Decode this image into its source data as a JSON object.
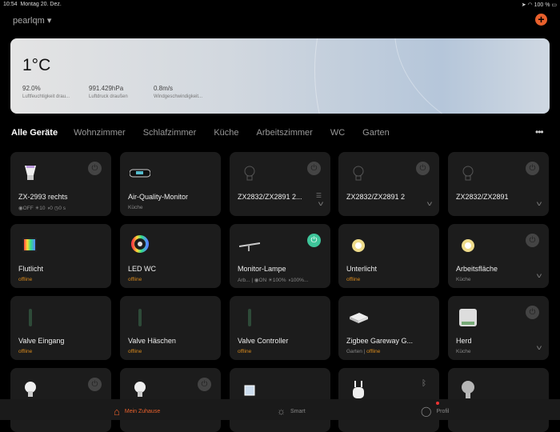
{
  "status_bar": {
    "time": "10:54",
    "date": "Montag 20. Dez.",
    "battery": "100 %"
  },
  "header": {
    "home_name": "pearlqm",
    "add_icon": "plus-icon"
  },
  "weather": {
    "temperature": "1°C",
    "stats": [
      {
        "value": "92.0%",
        "label": "Luftfeuchtigkeit drau..."
      },
      {
        "value": "991.429hPa",
        "label": "Luftdruck draußen"
      },
      {
        "value": "0.8m/s",
        "label": "Windgeschwindigkeit..."
      }
    ]
  },
  "tabs": [
    "Alle Geräte",
    "Wohnzimmer",
    "Schlafzimmer",
    "Küche",
    "Arbeitszimmer",
    "WC",
    "Garten"
  ],
  "more_label": "•••",
  "colors": {
    "accent": "#e8602c",
    "on": "#3ec59a",
    "offline": "#d88a1c",
    "card": "#1c1c1c"
  },
  "devices": [
    {
      "name": "ZX-2993 rechts",
      "sub": "◉OFF  ☀10  ◑0  ◷0 s",
      "icon": "spot-bulb",
      "power": "off"
    },
    {
      "name": "Air-Quality-Monitor",
      "sub": "Küche",
      "icon": "air-monitor"
    },
    {
      "name": "ZX2832/ZX2891 2...",
      "sub": "",
      "icon": "bulb-outline",
      "power": "off",
      "chevron": true,
      "group": true
    },
    {
      "name": "ZX2832/ZX2891 2",
      "sub": "",
      "icon": "bulb-outline",
      "power": "off",
      "chevron": true
    },
    {
      "name": "ZX2832/ZX2891",
      "sub": "",
      "icon": "bulb-outline",
      "power": "off",
      "chevron": true
    },
    {
      "name": "Flutlicht",
      "offline": "offline",
      "icon": "floodlight"
    },
    {
      "name": "LED WC",
      "offline": "offline",
      "icon": "ring-light"
    },
    {
      "name": "Monitor-Lampe",
      "sub": "Arb...  |  ◉ON  ☀100%  ◑100%...",
      "icon": "monitor-lamp",
      "power": "on"
    },
    {
      "name": "Unterlicht",
      "offline": "offline",
      "icon": "ring-light-yellow"
    },
    {
      "name": "Arbeitsfläche",
      "sub": "Küche",
      "icon": "ring-light-yellow",
      "power": "off",
      "chevron": true
    },
    {
      "name": "Valve Eingang",
      "offline": "offline",
      "icon": "valve"
    },
    {
      "name": "Valve  Häschen",
      "offline": "offline",
      "icon": "valve"
    },
    {
      "name": "Valve Controller",
      "offline": "offline",
      "icon": "valve"
    },
    {
      "name": "Zigbee  Gareway G...",
      "sub": "Garten  |  ",
      "offline": "offline",
      "icon": "gateway"
    },
    {
      "name": "Herd",
      "sub": "Küche",
      "icon": "switch-module",
      "power": "off",
      "chevron": true
    },
    {
      "name": "",
      "icon": "bulb",
      "power": "off"
    },
    {
      "name": "",
      "icon": "bulb",
      "power": "off"
    },
    {
      "name": "",
      "icon": "sensor"
    },
    {
      "name": "",
      "icon": "earbuds",
      "bluetooth": true
    },
    {
      "name": "",
      "icon": "filament-bulb"
    }
  ],
  "bottom_nav": [
    {
      "label": "Mein Zuhause",
      "icon": "home-icon",
      "active": true
    },
    {
      "label": "Smart",
      "icon": "sun-icon"
    },
    {
      "label": "Profil",
      "icon": "user-icon"
    }
  ]
}
